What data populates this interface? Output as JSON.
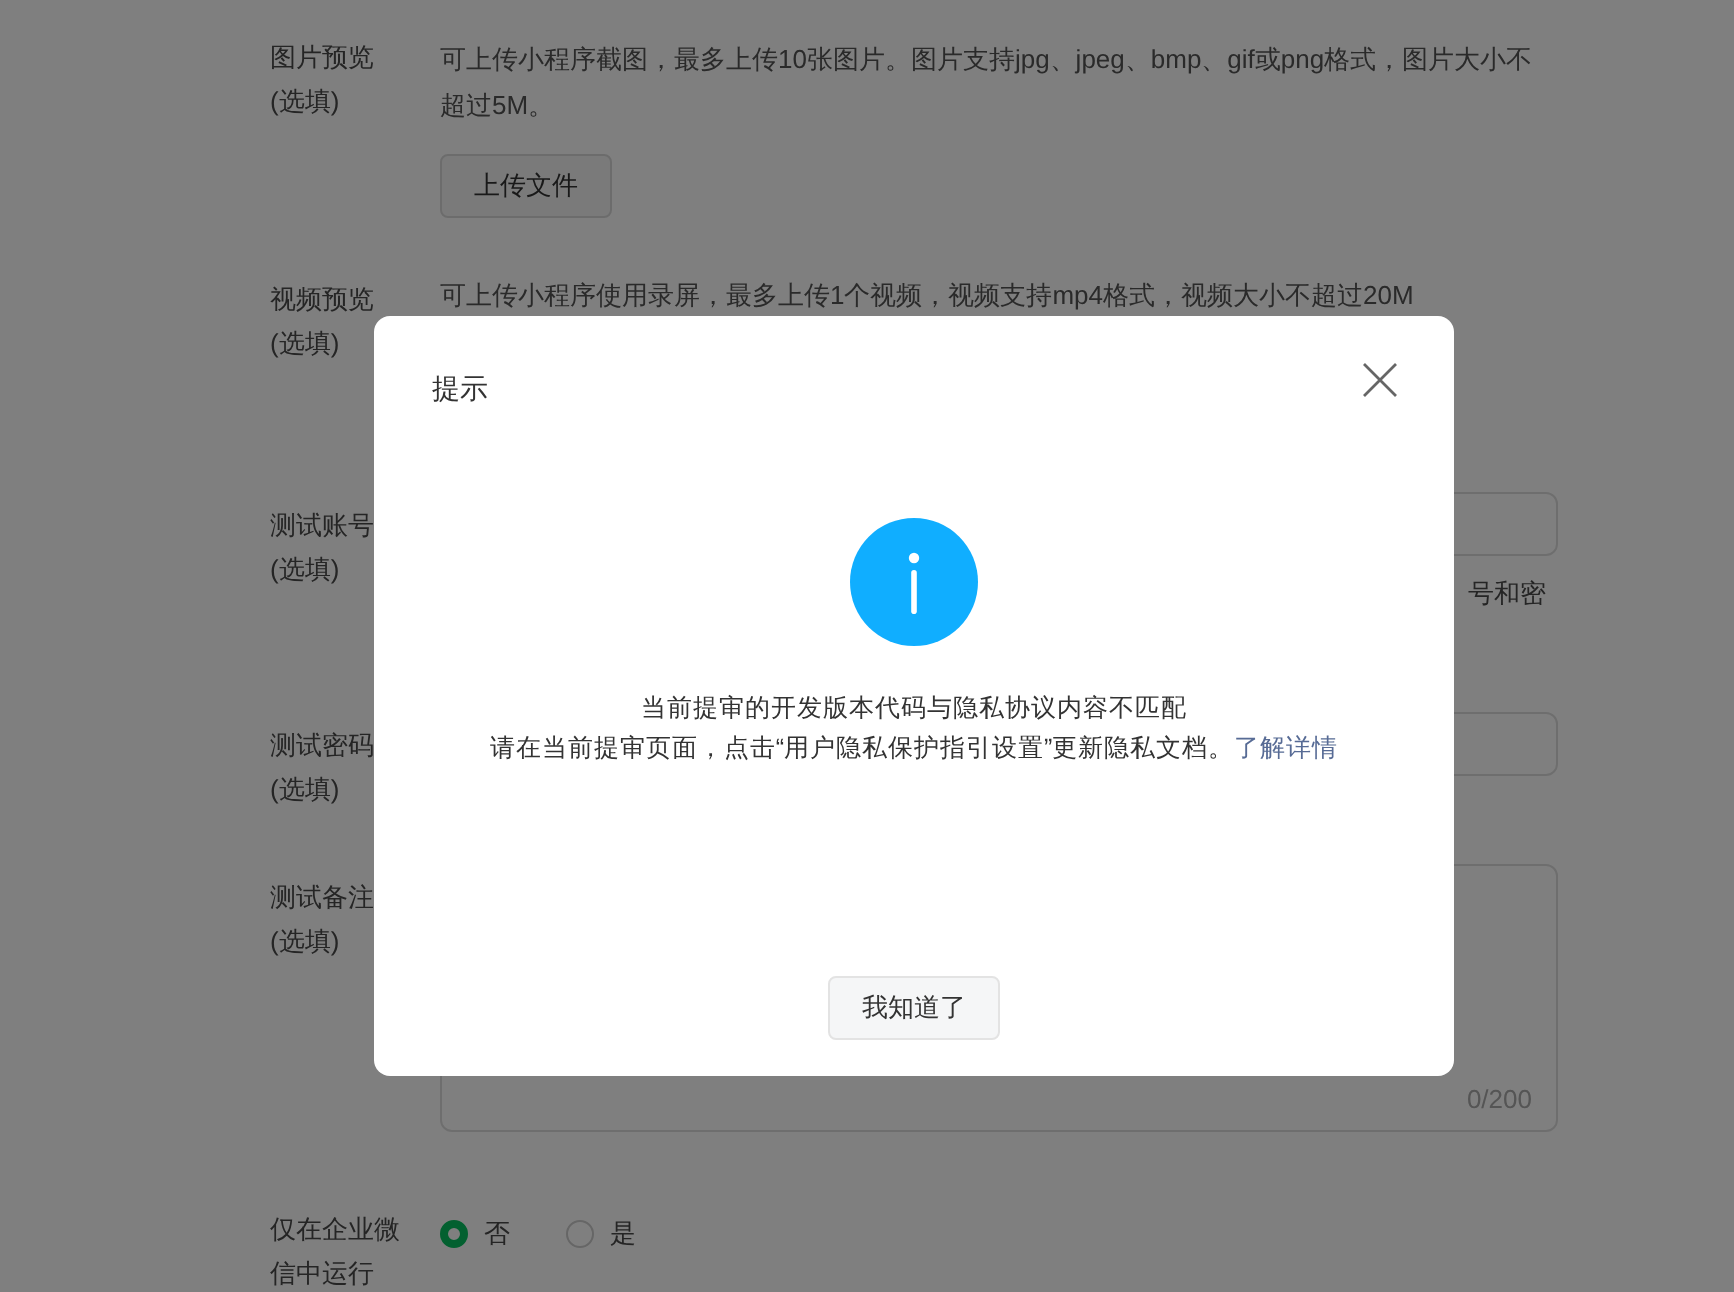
{
  "form": {
    "rows": [
      {
        "kind": "upload",
        "label": "图片预览",
        "sublabel": "(选填)",
        "description": "可上传小程序截图，最多上传10张图片。图片支持jpg、jpeg、bmp、gif或png格式，图片大小不超过5M。",
        "button": "上传文件"
      },
      {
        "kind": "text",
        "label": "视频预览",
        "sublabel": "(选填)",
        "description": "可上传小程序使用录屏，最多上传1个视频，视频支持mp4格式，视频大小不超过20M"
      },
      {
        "kind": "input",
        "label": "测试账号",
        "sublabel": "(选填)",
        "hint": "号和密"
      },
      {
        "kind": "input",
        "label": "测试密码",
        "sublabel": "(选填)"
      },
      {
        "kind": "textarea",
        "label": "测试备注",
        "sublabel": "(选填)",
        "counter": "0/200"
      },
      {
        "kind": "radio",
        "label": "仅在企业微信中运行",
        "options": [
          {
            "label": "否",
            "selected": true
          },
          {
            "label": "是",
            "selected": false
          }
        ]
      }
    ]
  },
  "dialog": {
    "title": "提示",
    "message_lines": [
      "当前提审的开发版本代码与隐私协议内容不匹配",
      "请在当前提审页面，点击“用户隐私保护指引设置”更新隐私文档。"
    ],
    "link": "了解详情",
    "button": "我知道了"
  }
}
